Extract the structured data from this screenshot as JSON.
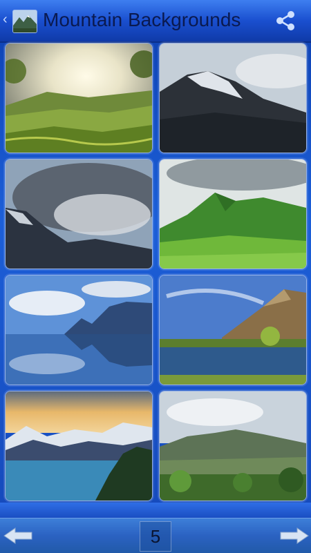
{
  "header": {
    "title": "Mountain Backgrounds",
    "back_icon": "chevron-left-icon",
    "app_icon": "mountain-thumbnail-icon",
    "share_icon": "share-icon"
  },
  "gallery": {
    "items": [
      {
        "subject": "sunlit tea plantation hills"
      },
      {
        "subject": "snow-dusted dark peak in mist"
      },
      {
        "subject": "stormy clouds over mountain ridge"
      },
      {
        "subject": "green grassy mountain slopes"
      },
      {
        "subject": "mountains reflected in blue lake"
      },
      {
        "subject": "peaks over calm reflective lake"
      },
      {
        "subject": "snowy range at sunset over lake"
      },
      {
        "subject": "forested green hills under clouds"
      }
    ]
  },
  "pager": {
    "current_page": "5",
    "prev_icon": "arrow-left-icon",
    "next_icon": "arrow-right-icon"
  },
  "colors": {
    "header": "#1a4fcf",
    "background": "#1c5fd8",
    "title_text": "#0a1a50"
  }
}
